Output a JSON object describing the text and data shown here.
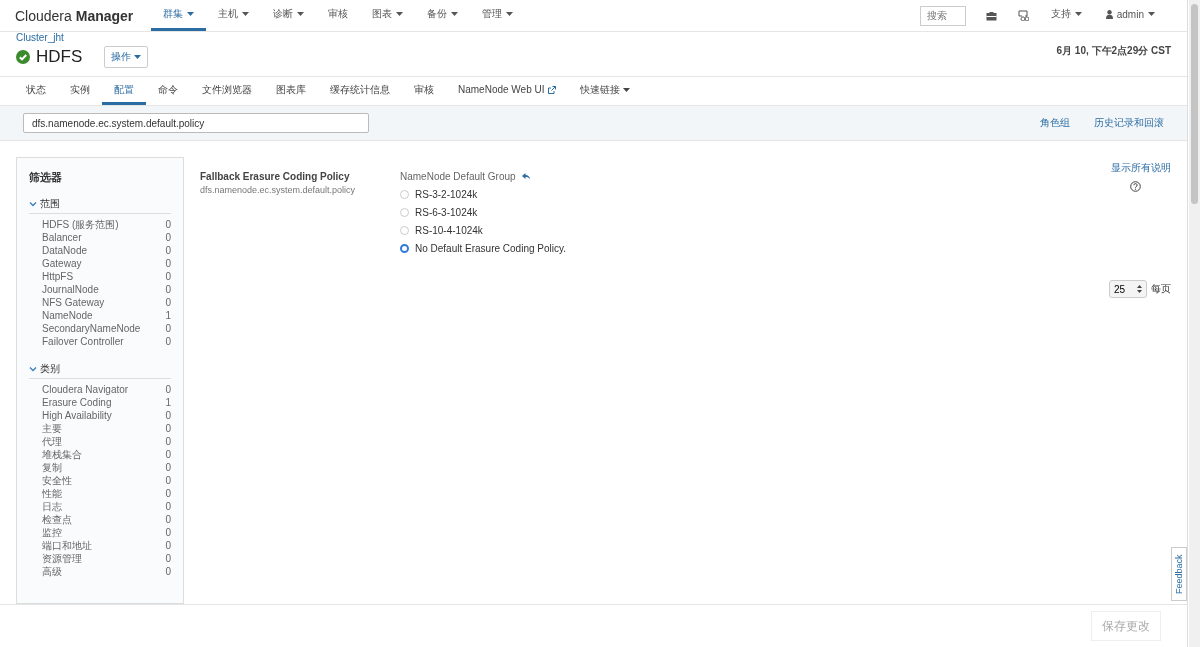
{
  "brand": {
    "light": "Cloudera",
    "bold": "Manager"
  },
  "nav": [
    {
      "label": "群集",
      "dropdown": true,
      "selected": true
    },
    {
      "label": "主机",
      "dropdown": true,
      "selected": false
    },
    {
      "label": "诊断",
      "dropdown": true,
      "selected": false
    },
    {
      "label": "审核",
      "dropdown": false,
      "selected": false
    },
    {
      "label": "图表",
      "dropdown": true,
      "selected": false
    },
    {
      "label": "备份",
      "dropdown": true,
      "selected": false
    },
    {
      "label": "管理",
      "dropdown": true,
      "selected": false
    }
  ],
  "nav_search": {
    "placeholder": "搜索"
  },
  "support": {
    "label": "支持"
  },
  "user": {
    "label": "admin"
  },
  "breadcrumb": "Cluster_jht",
  "service": {
    "name": "HDFS",
    "healthy": true,
    "actions": "操作"
  },
  "timestamp": "6月 10, 下午2点29分 CST",
  "tabs": [
    {
      "label": "状态",
      "selected": false,
      "kind": "plain"
    },
    {
      "label": "实例",
      "selected": false,
      "kind": "plain"
    },
    {
      "label": "配置",
      "selected": true,
      "kind": "plain"
    },
    {
      "label": "命令",
      "selected": false,
      "kind": "plain"
    },
    {
      "label": "文件浏览器",
      "selected": false,
      "kind": "plain"
    },
    {
      "label": "图表库",
      "selected": false,
      "kind": "plain"
    },
    {
      "label": "缓存统计信息",
      "selected": false,
      "kind": "plain"
    },
    {
      "label": "审核",
      "selected": false,
      "kind": "plain"
    },
    {
      "label": "NameNode Web UI",
      "selected": false,
      "kind": "external"
    },
    {
      "label": "快速链接",
      "selected": false,
      "kind": "dropdown"
    }
  ],
  "config_search": {
    "value": "dfs.namenode.ec.system.default.policy"
  },
  "links": [
    "角色组",
    "历史记录和回滚"
  ],
  "filters": {
    "title": "筛选器",
    "groups": [
      {
        "title": "范围",
        "expanded": true,
        "items": [
          {
            "label": "HDFS (服务范围)",
            "count": "0"
          },
          {
            "label": "Balancer",
            "count": "0"
          },
          {
            "label": "DataNode",
            "count": "0"
          },
          {
            "label": "Gateway",
            "count": "0"
          },
          {
            "label": "HttpFS",
            "count": "0"
          },
          {
            "label": "JournalNode",
            "count": "0"
          },
          {
            "label": "NFS Gateway",
            "count": "0"
          },
          {
            "label": "NameNode",
            "count": "1"
          },
          {
            "label": "SecondaryNameNode",
            "count": "0"
          },
          {
            "label": "Failover Controller",
            "count": "0"
          }
        ]
      },
      {
        "title": "类别",
        "expanded": true,
        "items": [
          {
            "label": "Cloudera Navigator",
            "count": "0"
          },
          {
            "label": "Erasure Coding",
            "count": "1"
          },
          {
            "label": "High Availability",
            "count": "0"
          },
          {
            "label": "主要",
            "count": "0"
          },
          {
            "label": "代理",
            "count": "0"
          },
          {
            "label": "堆栈集合",
            "count": "0"
          },
          {
            "label": "复制",
            "count": "0"
          },
          {
            "label": "安全性",
            "count": "0"
          },
          {
            "label": "性能",
            "count": "0"
          },
          {
            "label": "日志",
            "count": "0"
          },
          {
            "label": "检查点",
            "count": "0"
          },
          {
            "label": "监控",
            "count": "0"
          },
          {
            "label": "端口和地址",
            "count": "0"
          },
          {
            "label": "资源管理",
            "count": "0"
          },
          {
            "label": "高级",
            "count": "0"
          }
        ]
      }
    ]
  },
  "show_all_desc": "显示所有说明",
  "property": {
    "title": "Fallback Erasure Coding Policy",
    "key": "dfs.namenode.ec.system.default.policy",
    "group": "NameNode Default Group",
    "options": [
      {
        "label": "RS-3-2-1024k",
        "selected": false
      },
      {
        "label": "RS-6-3-1024k",
        "selected": false
      },
      {
        "label": "RS-10-4-1024k",
        "selected": false
      },
      {
        "label": "No Default Erasure Coding Policy.",
        "selected": true
      }
    ]
  },
  "page_size": {
    "value": "25",
    "label": "每页"
  },
  "feedback": "Feedback",
  "save_button": {
    "label": "保存更改",
    "disabled": true
  }
}
